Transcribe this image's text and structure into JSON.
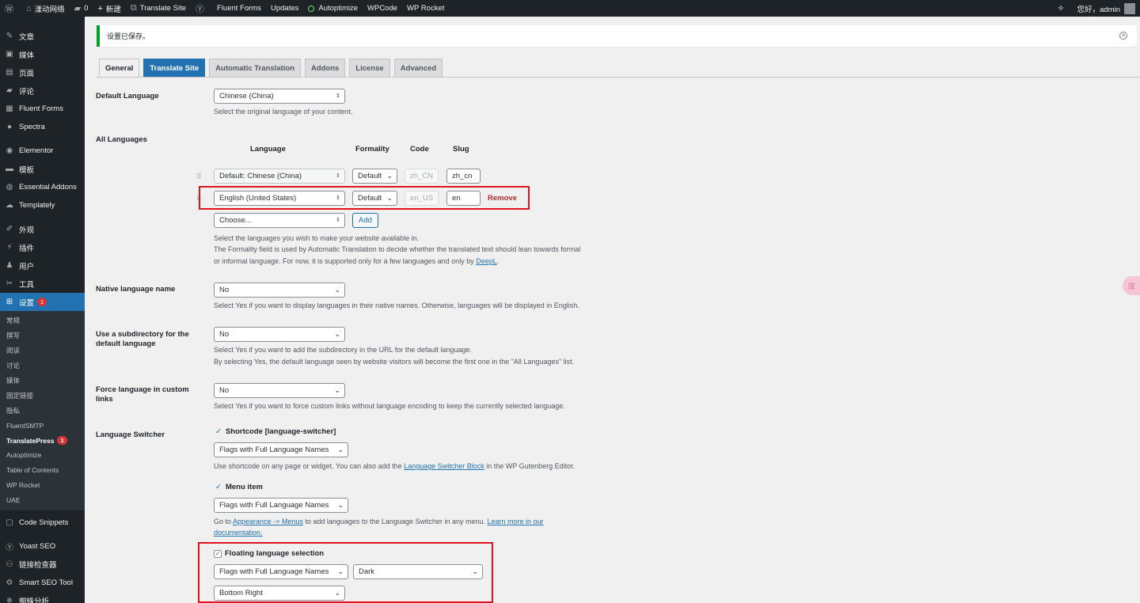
{
  "adminbar": {
    "site_name": "漾动网络",
    "comments_count": "0",
    "new_label": "新建",
    "translate_site": "Translate Site",
    "fluent_forms": "Fluent Forms",
    "updates": "Updates",
    "autoptimize": "Autoptimize",
    "wpcode": "WPCode",
    "wp_rocket": "WP Rocket",
    "greeting": "您好，admin"
  },
  "sidebar": {
    "items": [
      {
        "label": "文章",
        "icon": "pin-icon"
      },
      {
        "label": "媒体",
        "icon": "media-icon"
      },
      {
        "label": "页面",
        "icon": "page-icon"
      },
      {
        "label": "评论",
        "icon": "comment-icon"
      },
      {
        "label": "Fluent Forms",
        "icon": "forms-icon"
      },
      {
        "label": "Spectra",
        "icon": "spectra-icon"
      },
      {
        "label": "Elementor",
        "icon": "elementor-icon"
      },
      {
        "label": "模板",
        "icon": "folder-icon"
      },
      {
        "label": "Essential Addons",
        "icon": "ea-icon"
      },
      {
        "label": "Templately",
        "icon": "templately-icon"
      },
      {
        "label": "外观",
        "icon": "brush-icon"
      },
      {
        "label": "插件",
        "icon": "plugin-icon"
      },
      {
        "label": "用户",
        "icon": "user-icon"
      },
      {
        "label": "工具",
        "icon": "wrench-icon"
      },
      {
        "label": "设置",
        "icon": "settings-icon",
        "badge": "1"
      }
    ],
    "submenu": [
      "常规",
      "撰写",
      "阅读",
      "讨论",
      "媒体",
      "固定链接",
      "隐私",
      "FluentSMTP",
      "TranslatePress",
      "Autoptimize",
      "Table of Contents",
      "WP Rocket",
      "UAE"
    ],
    "submenu_badge": "1",
    "bottom_items": [
      {
        "label": "Code Snippets",
        "icon": "code-icon"
      },
      {
        "label": "Yoast SEO",
        "icon": "yoast-icon"
      },
      {
        "label": "链接检查器",
        "icon": "link-icon"
      },
      {
        "label": "Smart SEO Tool",
        "icon": "seo-icon"
      },
      {
        "label": "蜘蛛分析",
        "icon": "spider-icon"
      }
    ]
  },
  "notice": {
    "text": "设置已保存。"
  },
  "tabs": [
    "General",
    "Translate Site",
    "Automatic Translation",
    "Addons",
    "License",
    "Advanced"
  ],
  "default_language": {
    "label": "Default Language",
    "value": "Chinese (China)",
    "desc": "Select the original language of your content."
  },
  "all_languages": {
    "label": "All Languages",
    "headers": {
      "language": "Language",
      "formality": "Formality",
      "code": "Code",
      "slug": "Slug"
    },
    "rows": [
      {
        "language": "Default: Chinese (China)",
        "formality": "Default",
        "code": "zh_CN",
        "slug": "zh_cn"
      },
      {
        "language": "English (United States)",
        "formality": "Default",
        "code": "en_US",
        "slug": "en",
        "remove": "Remove"
      }
    ],
    "choose_placeholder": "Choose...",
    "add_label": "Add",
    "desc1": "Select the languages you wish to make your website available in.",
    "desc2": "The Formality field is used by Automatic Translation to decide whether the translated text should lean towards formal",
    "desc3_pre": "or informal language. For now, it is supported only for a few languages and only by ",
    "desc3_link": "DeepL",
    "desc3_post": "."
  },
  "native_name": {
    "label": "Native language name",
    "value": "No",
    "desc": "Select Yes if you want to display languages in their native names. Otherwise, languages will be displayed in English."
  },
  "subdirectory": {
    "label": "Use a subdirectory for the default language",
    "value": "No",
    "desc1": "Select Yes if you want to add the subdirectory in the URL for the default language.",
    "desc2": "By selecting Yes, the default language seen by website visitors will become the first one in the \"All Languages\" list."
  },
  "force_language": {
    "label": "Force language in custom links",
    "value": "No",
    "desc": "Select Yes if you want to force custom links without language encoding to keep the currently selected language."
  },
  "switcher": {
    "label": "Language Switcher",
    "shortcode_label": "Shortcode [language-switcher]",
    "shortcode_value": "Flags with Full Language Names",
    "shortcode_desc_pre": "Use shortcode on any page or widget. You can also add the ",
    "shortcode_desc_link": "Language Switcher Block",
    "shortcode_desc_post": " in the WP Gutenberg Editor.",
    "menu_label": "Menu item",
    "menu_value": "Flags with Full Language Names",
    "menu_desc_pre": "Go to ",
    "menu_desc_link1": "Appearance -> Menus",
    "menu_desc_mid": " to add languages to the Language Switcher in any menu. ",
    "menu_desc_link2": "Learn more in our",
    "menu_desc_link3": "documentation.",
    "floating_label": "Floating language selection",
    "floating_value": "Flags with Full Language Names",
    "floating_theme": "Dark",
    "floating_position": "Bottom Right"
  },
  "floater": "汉",
  "colors": {
    "accent": "#2271b1",
    "sidebar_bg": "#1d2327",
    "highlight": "#e0141c",
    "success": "#00a32a"
  }
}
